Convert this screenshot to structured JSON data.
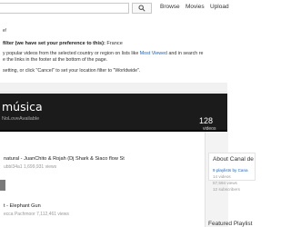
{
  "topbar": {
    "search_value": "",
    "nav": [
      "Browse",
      "Movies",
      "Upload"
    ]
  },
  "notice": {
    "line1": "e!",
    "line2_bold": "filter (we have set your preference to this):",
    "line2_rest": " France",
    "line3_a": "y popular videos from the selected country or region on lists like ",
    "line3_link": "Most Viewed",
    "line3_b": " and in search re",
    "line4": "e the links in the footer at the bottom of the page.",
    "line5": "setting, or click \"Cancel\" to set your location filter to \"Worldwide\"."
  },
  "channel": {
    "title": "música",
    "author": "NoLoveAvailable",
    "video_count": "128",
    "video_count_label": "videos"
  },
  "videos": [
    {
      "title": "natural - JuanChito & Rojah (Dj Shark & Siaco flow St",
      "meta": "ubbl34a1   1,699,931 views"
    },
    {
      "title": "t - Elephant Gun",
      "meta": "ecca Pachmoor   7,112,461 views"
    }
  ],
  "sidebar": {
    "about_title": "About Canal de",
    "playlists": "9 playlists by Cana",
    "stats": [
      "14 videos",
      "57,594 views",
      "12 subscribers"
    ],
    "featured": "Featured Playlist"
  },
  "colors": {
    "link": "#1c62b9",
    "header_bg": "#1b1b1b"
  }
}
